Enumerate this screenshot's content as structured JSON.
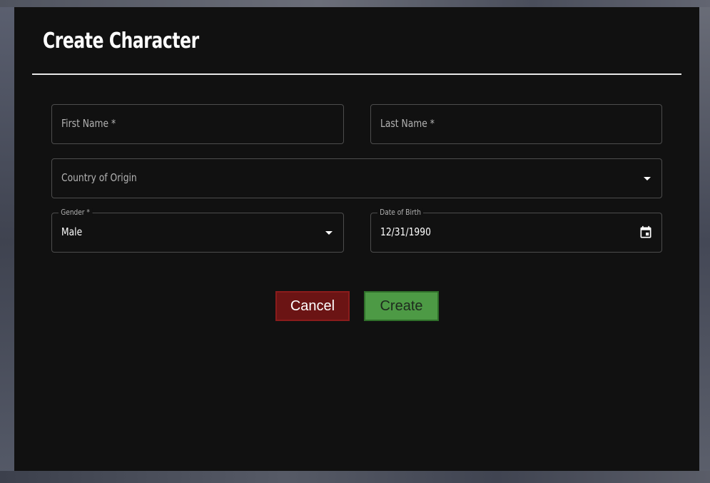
{
  "dialog": {
    "title": "Create Character"
  },
  "form": {
    "first_name": {
      "placeholder": "First Name *",
      "value": ""
    },
    "last_name": {
      "placeholder": "Last Name *",
      "value": ""
    },
    "country": {
      "placeholder": "Country of Origin",
      "value": ""
    },
    "gender": {
      "label": "Gender *",
      "value": "Male"
    },
    "dob": {
      "label": "Date of Birth",
      "value": "12/31/1990"
    }
  },
  "actions": {
    "cancel_label": "Cancel",
    "create_label": "Create"
  },
  "icons": {
    "dropdown": "caret-down-icon",
    "calendar": "calendar-icon"
  },
  "colors": {
    "dialog_bg": "#111111",
    "cancel_bg": "#6b1414",
    "create_bg": "#4d9a45"
  }
}
